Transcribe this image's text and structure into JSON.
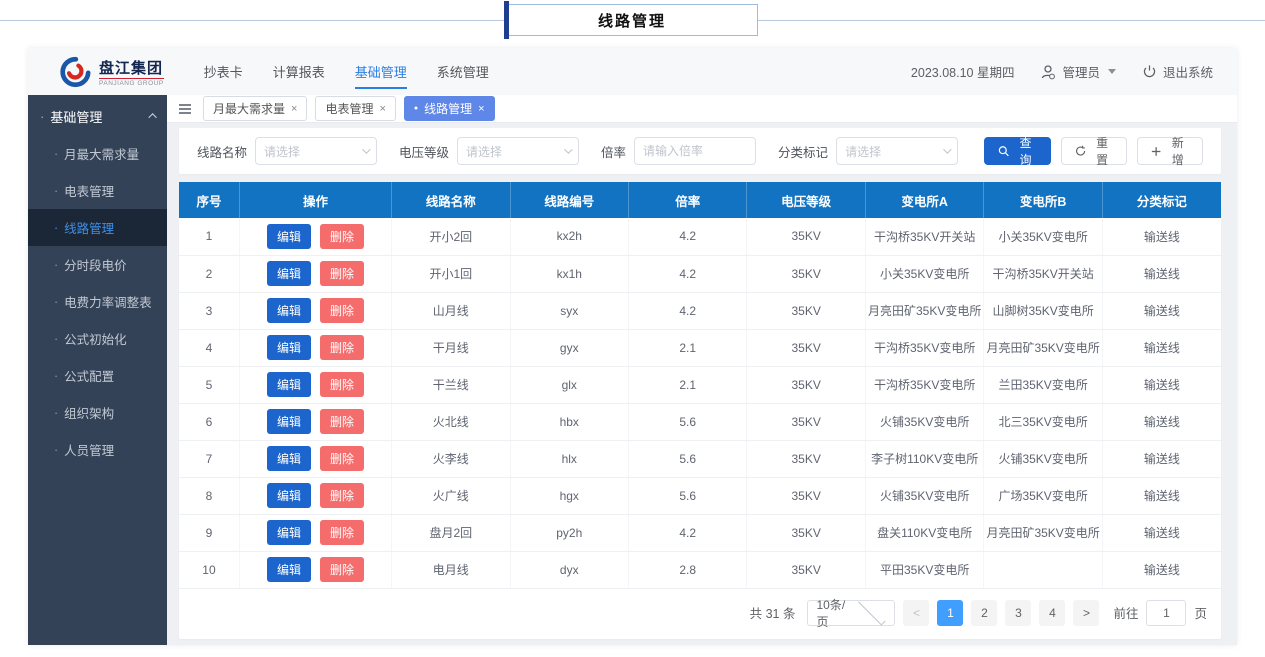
{
  "overlay": {
    "title": "线路管理"
  },
  "icons": {
    "close": "×",
    "dot": "●",
    "bullet": "·"
  },
  "colors": {
    "primary": "#1b65cd",
    "table_header": "#1173c2",
    "danger": "#f56c6c",
    "tab_active": "#5f87e8",
    "sidebar_bg": "#344258",
    "page_active": "#409eff"
  },
  "header": {
    "logo": {
      "cn": "盘江集团",
      "en": "PANJIANG GROUP"
    },
    "nav": [
      {
        "label": "抄表卡",
        "active": false
      },
      {
        "label": "计算报表",
        "active": false
      },
      {
        "label": "基础管理",
        "active": true
      },
      {
        "label": "系统管理",
        "active": false
      }
    ],
    "date": "2023.08.10 星期四",
    "user": "管理员",
    "logout": "退出系统"
  },
  "sidebar": {
    "group": "基础管理",
    "items": [
      {
        "label": "月最大需求量",
        "active": false
      },
      {
        "label": "电表管理",
        "active": false
      },
      {
        "label": "线路管理",
        "active": true
      },
      {
        "label": "分时段电价",
        "active": false
      },
      {
        "label": "电费力率调整表",
        "active": false
      },
      {
        "label": "公式初始化",
        "active": false
      },
      {
        "label": "公式配置",
        "active": false
      },
      {
        "label": "组织架构",
        "active": false
      },
      {
        "label": "人员管理",
        "active": false
      }
    ]
  },
  "tabs": [
    {
      "label": "月最大需求量",
      "active": false
    },
    {
      "label": "电表管理",
      "active": false
    },
    {
      "label": "线路管理",
      "active": true
    }
  ],
  "filters": {
    "fields": [
      {
        "label": "线路名称",
        "placeholder": "请选择",
        "type": "select"
      },
      {
        "label": "电压等级",
        "placeholder": "请选择",
        "type": "select"
      },
      {
        "label": "倍率",
        "placeholder": "请输入倍率",
        "type": "input"
      },
      {
        "label": "分类标记",
        "placeholder": "请选择",
        "type": "select"
      }
    ],
    "buttons": {
      "search": "查询",
      "reset": "重置",
      "add": "新增"
    }
  },
  "table": {
    "columns": [
      "序号",
      "操作",
      "线路名称",
      "线路编号",
      "倍率",
      "电压等级",
      "变电所A",
      "变电所B",
      "分类标记"
    ],
    "action_labels": {
      "edit": "编辑",
      "delete": "删除"
    },
    "rows": [
      {
        "index": "1",
        "name": "开小2回",
        "code": "kx2h",
        "ratio": "4.2",
        "voltage": "35KV",
        "station_a": "干沟桥35KV开关站",
        "station_b": "小关35KV变电所",
        "tag": "输送线"
      },
      {
        "index": "2",
        "name": "开小1回",
        "code": "kx1h",
        "ratio": "4.2",
        "voltage": "35KV",
        "station_a": "小关35KV变电所",
        "station_b": "干沟桥35KV开关站",
        "tag": "输送线"
      },
      {
        "index": "3",
        "name": "山月线",
        "code": "syx",
        "ratio": "4.2",
        "voltage": "35KV",
        "station_a": "月亮田矿35KV变电所",
        "station_b": "山脚树35KV变电所",
        "tag": "输送线"
      },
      {
        "index": "4",
        "name": "干月线",
        "code": "gyx",
        "ratio": "2.1",
        "voltage": "35KV",
        "station_a": "干沟桥35KV变电所",
        "station_b": "月亮田矿35KV变电所",
        "tag": "输送线"
      },
      {
        "index": "5",
        "name": "干兰线",
        "code": "glx",
        "ratio": "2.1",
        "voltage": "35KV",
        "station_a": "干沟桥35KV变电所",
        "station_b": "兰田35KV变电所",
        "tag": "输送线"
      },
      {
        "index": "6",
        "name": "火北线",
        "code": "hbx",
        "ratio": "5.6",
        "voltage": "35KV",
        "station_a": "火铺35KV变电所",
        "station_b": "北三35KV变电所",
        "tag": "输送线"
      },
      {
        "index": "7",
        "name": "火李线",
        "code": "hlx",
        "ratio": "5.6",
        "voltage": "35KV",
        "station_a": "李子树110KV变电所",
        "station_b": "火铺35KV变电所",
        "tag": "输送线"
      },
      {
        "index": "8",
        "name": "火广线",
        "code": "hgx",
        "ratio": "5.6",
        "voltage": "35KV",
        "station_a": "火铺35KV变电所",
        "station_b": "广场35KV变电所",
        "tag": "输送线"
      },
      {
        "index": "9",
        "name": "盘月2回",
        "code": "py2h",
        "ratio": "4.2",
        "voltage": "35KV",
        "station_a": "盘关110KV变电所",
        "station_b": "月亮田矿35KV变电所",
        "tag": "输送线"
      },
      {
        "index": "10",
        "name": "电月线",
        "code": "dyx",
        "ratio": "2.8",
        "voltage": "35KV",
        "station_a": "平田35KV变电所",
        "station_b": "",
        "tag": "输送线"
      }
    ]
  },
  "pagination": {
    "total": "共 31 条",
    "page_size": "10条/页",
    "pages": [
      "1",
      "2",
      "3",
      "4"
    ],
    "active_page": "1",
    "goto_label": "前往",
    "goto_value": "1",
    "page_suffix": "页"
  }
}
